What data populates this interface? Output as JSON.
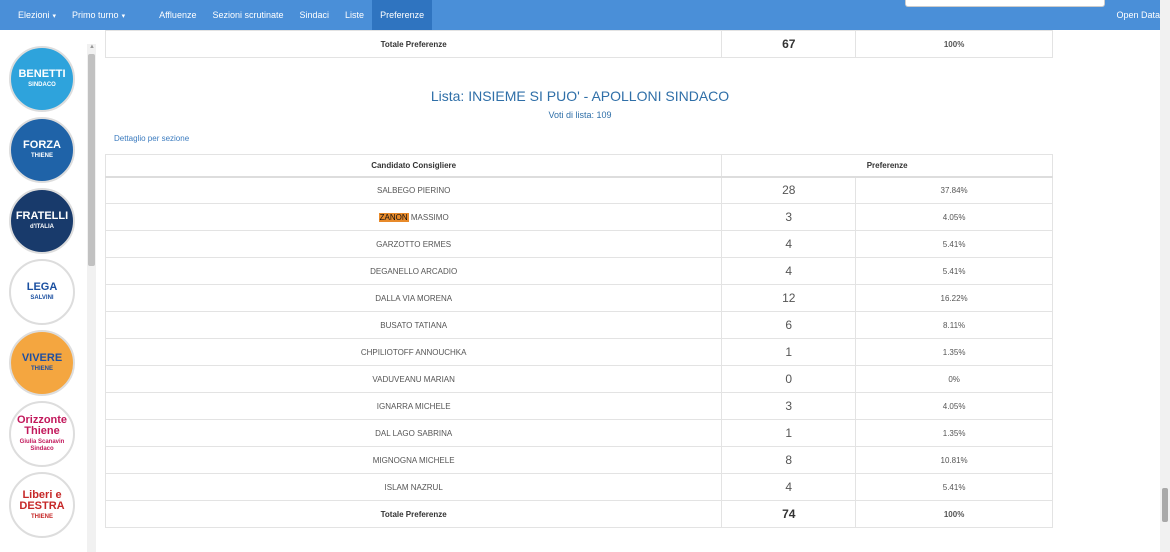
{
  "nav": {
    "items": [
      {
        "label": "Elezioni",
        "caret": "▾"
      },
      {
        "label": "Primo turno",
        "caret": "▾"
      },
      {
        "label": "Affluenze",
        "caret": ""
      },
      {
        "label": "Sezioni scrutinate",
        "caret": ""
      },
      {
        "label": "Sindaci",
        "caret": ""
      },
      {
        "label": "Liste",
        "caret": ""
      },
      {
        "label": "Preferenze",
        "caret": ""
      }
    ],
    "active": "Preferenze",
    "right_label": "Open Data"
  },
  "sidebar": {
    "logos": [
      {
        "line1": "BENETTI",
        "line2": "SINDACO",
        "bg": "#2ea3dc",
        "fg": "#ffffff"
      },
      {
        "line1": "FORZA",
        "line2": "THIENE",
        "bg": "#1f63a8",
        "fg": "#ffffff"
      },
      {
        "line1": "FRATELLI",
        "line2": "d'ITALIA",
        "bg": "#183a6b",
        "fg": "#ffffff"
      },
      {
        "line1": "LEGA",
        "line2": "SALVINI",
        "bg": "#ffffff",
        "fg": "#1a4fa0"
      },
      {
        "line1": "VIVERE",
        "line2": "THIENE",
        "bg": "#f4a640",
        "fg": "#1f4fa0"
      },
      {
        "line1": "Orizzonte Thiene",
        "line2": "Giulia Scanavin Sindaco",
        "bg": "#ffffff",
        "fg": "#c2185b"
      },
      {
        "line1": "Liberi e DESTRA",
        "line2": "THIENE",
        "bg": "#ffffff",
        "fg": "#c62828"
      }
    ]
  },
  "prev_total": {
    "label": "Totale Preferenze",
    "votes": "67",
    "pct": "100%"
  },
  "list": {
    "title": "Lista: INSIEME SI PUO' - APOLLONI SINDACO",
    "subtitle": "Voti di lista: 109",
    "detail_link": "Dettaglio per sezione",
    "headers": {
      "candidate": "Candidato Consigliere",
      "prefs": "Preferenze"
    },
    "rows": [
      {
        "hl": "",
        "name": "SALBEGO PIERINO",
        "votes": "28",
        "pct": "37.84%"
      },
      {
        "hl": "ZANON",
        "name": " MASSIMO",
        "votes": "3",
        "pct": "4.05%"
      },
      {
        "hl": "",
        "name": "GARZOTTO ERMES",
        "votes": "4",
        "pct": "5.41%"
      },
      {
        "hl": "",
        "name": "DEGANELLO ARCADIO",
        "votes": "4",
        "pct": "5.41%"
      },
      {
        "hl": "",
        "name": "DALLA VIA MORENA",
        "votes": "12",
        "pct": "16.22%"
      },
      {
        "hl": "",
        "name": "BUSATO TATIANA",
        "votes": "6",
        "pct": "8.11%"
      },
      {
        "hl": "",
        "name": "CHPILIOTOFF ANNOUCHKA",
        "votes": "1",
        "pct": "1.35%"
      },
      {
        "hl": "",
        "name": "VADUVEANU MARIAN",
        "votes": "0",
        "pct": "0%"
      },
      {
        "hl": "",
        "name": "IGNARRA MICHELE",
        "votes": "3",
        "pct": "4.05%"
      },
      {
        "hl": "",
        "name": "DAL LAGO SABRINA",
        "votes": "1",
        "pct": "1.35%"
      },
      {
        "hl": "",
        "name": "MIGNOGNA MICHELE",
        "votes": "8",
        "pct": "10.81%"
      },
      {
        "hl": "",
        "name": "ISLAM NAZRUL",
        "votes": "4",
        "pct": "5.41%"
      }
    ],
    "total": {
      "label": "Totale Preferenze",
      "votes": "74",
      "pct": "100%"
    }
  },
  "colors": {
    "navbar": "#4a8fd8",
    "nav_active": "#2f74c0",
    "link": "#2f6fa8",
    "highlight": "#e88a2a"
  }
}
